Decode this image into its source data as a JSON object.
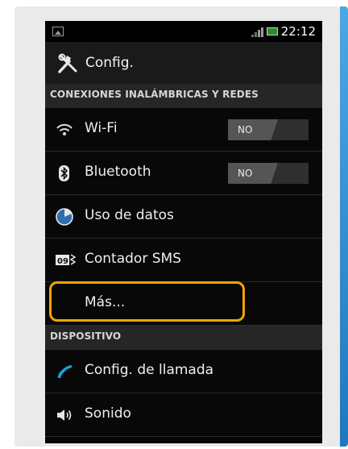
{
  "status_bar": {
    "time": "22:12"
  },
  "header": {
    "title": "Config."
  },
  "sections": [
    {
      "title": "CONEXIONES INALÁMBRICAS Y REDES",
      "items": [
        {
          "label": "Wi-Fi",
          "icon": "wifi-icon",
          "toggle": "NO"
        },
        {
          "label": "Bluetooth",
          "icon": "bluetooth-icon",
          "toggle": "NO"
        },
        {
          "label": "Uso de datos",
          "icon": "data-usage-icon"
        },
        {
          "label": "Contador SMS",
          "icon": "sms-counter-icon",
          "icon_text": "09"
        },
        {
          "label": "Más...",
          "highlighted": true
        }
      ]
    },
    {
      "title": "DISPOSITIVO",
      "items": [
        {
          "label": "Config. de llamada",
          "icon": "phone-icon"
        },
        {
          "label": "Sonido",
          "icon": "speaker-icon"
        }
      ]
    }
  ],
  "colors": {
    "highlight": "#f0a500",
    "accent": "#2a8ad2",
    "screen_background": "#050505",
    "section_header": "#262626"
  }
}
